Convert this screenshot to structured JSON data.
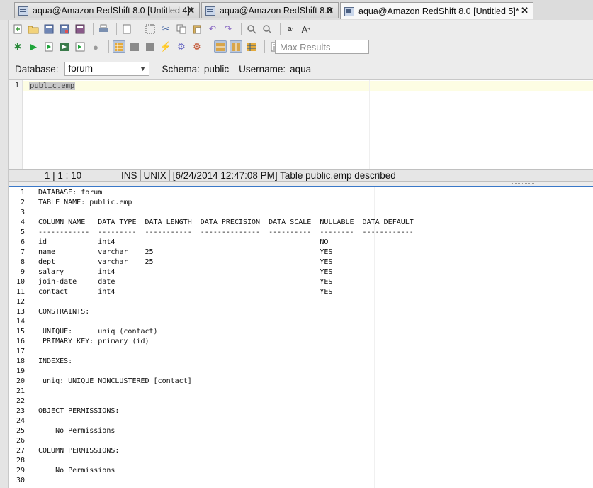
{
  "tabs": [
    {
      "label": "aqua@Amazon RedShift 8.0 [Untitled 4]*",
      "active": false
    },
    {
      "label": "aqua@Amazon RedShift 8.0",
      "active": false
    },
    {
      "label": "aqua@Amazon RedShift 8.0 [Untitled 5]*",
      "active": true
    }
  ],
  "tab_close": "✕",
  "toolbar": {
    "max_results_placeholder": "Max Results"
  },
  "connection": {
    "database_label": "Database:",
    "database_value": "forum",
    "schema_label": "Schema:",
    "schema_value": "public",
    "username_label": "Username:",
    "username_value": "aqua"
  },
  "editor": {
    "line_number": "1",
    "text": "public.emp"
  },
  "status": {
    "position": "1 | 1 : 10",
    "mode": "INS",
    "line_ending": "UNIX",
    "message": "[6/24/2014 12:47:08 PM] Table public.emp described"
  },
  "output": {
    "lines": [
      "DATABASE: forum",
      "TABLE NAME: public.emp",
      "",
      "COLUMN_NAME   DATA_TYPE  DATA_LENGTH  DATA_PRECISION  DATA_SCALE  NULLABLE  DATA_DEFAULT",
      "------------  ---------  -----------  --------------  ----------  --------  ------------",
      "id            int4                                                NO",
      "name          varchar    25                                       YES",
      "dept          varchar    25                                       YES",
      "salary        int4                                                YES",
      "join-date     date                                                YES",
      "contact       int4                                                YES",
      "",
      "CONSTRAINTS:",
      "",
      " UNIQUE:      uniq (contact)",
      " PRIMARY KEY: primary (id)",
      "",
      "INDEXES:",
      "",
      " uniq: UNIQUE NONCLUSTERED [contact]",
      "",
      "",
      "OBJECT PERMISSIONS:",
      "",
      "    No Permissions",
      "",
      "COLUMN PERMISSIONS:",
      "",
      "    No Permissions",
      ""
    ]
  }
}
